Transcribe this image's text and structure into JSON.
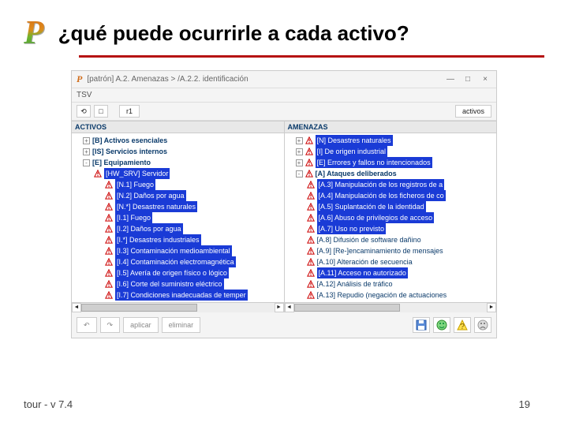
{
  "slide": {
    "title": "¿qué puede ocurrirle a cada activo?",
    "footer_left": "tour - v 7.4",
    "page_no": "19"
  },
  "app": {
    "titlebar": "[patrón] A.2. Amenazas > /A.2.2. identificación",
    "tab": "TSV",
    "toolbar": {
      "t1": "⟲",
      "t2": "□",
      "t3": "r1",
      "right": "activos"
    },
    "left_header": "ACTIVOS",
    "right_header": "AMENAZAS",
    "left_tree": [
      {
        "ind": 1,
        "plus": "+",
        "icon": "",
        "label": "[B] Activos esenciales",
        "cls": "public"
      },
      {
        "ind": 1,
        "plus": "+",
        "icon": "",
        "label": "[IS] Servicios internos",
        "cls": "public"
      },
      {
        "ind": 1,
        "plus": "-",
        "icon": "",
        "label": "[E] Equipamiento",
        "cls": "public"
      },
      {
        "ind": 2,
        "plus": "",
        "icon": "w",
        "label": "[HW_SRV] Servidor",
        "cls": "sel"
      },
      {
        "ind": 3,
        "plus": "",
        "icon": "w",
        "label": "[N.1] Fuego",
        "cls": "sel"
      },
      {
        "ind": 3,
        "plus": "",
        "icon": "w",
        "label": "[N.2] Daños por agua",
        "cls": "sel"
      },
      {
        "ind": 3,
        "plus": "",
        "icon": "w",
        "label": "[N.*] Desastres naturales",
        "cls": "sel"
      },
      {
        "ind": 3,
        "plus": "",
        "icon": "w",
        "label": "[I.1] Fuego",
        "cls": "sel"
      },
      {
        "ind": 3,
        "plus": "",
        "icon": "w",
        "label": "[I.2] Daños por agua",
        "cls": "sel"
      },
      {
        "ind": 3,
        "plus": "",
        "icon": "w",
        "label": "[I.*] Desastres industriales",
        "cls": "sel"
      },
      {
        "ind": 3,
        "plus": "",
        "icon": "w",
        "label": "[I.3] Contaminación medioambiental",
        "cls": "sel"
      },
      {
        "ind": 3,
        "plus": "",
        "icon": "w",
        "label": "[I.4] Contaminación electromagnética",
        "cls": "sel"
      },
      {
        "ind": 3,
        "plus": "",
        "icon": "w",
        "label": "[I.5] Avería de origen físico o lógico",
        "cls": "sel"
      },
      {
        "ind": 3,
        "plus": "",
        "icon": "w",
        "label": "[I.6] Corte del suministro eléctrico",
        "cls": "sel"
      },
      {
        "ind": 3,
        "plus": "",
        "icon": "w",
        "label": "[I.7] Condiciones inadecuadas de temper",
        "cls": "sel"
      }
    ],
    "right_tree": [
      {
        "ind": 1,
        "plus": "+",
        "icon": "w",
        "label": "[N] Desastres naturales",
        "cls": "sel"
      },
      {
        "ind": 1,
        "plus": "+",
        "icon": "w",
        "label": "[I] De origen industrial",
        "cls": "sel"
      },
      {
        "ind": 1,
        "plus": "+",
        "icon": "w",
        "label": "[E] Errores y fallos no intencionados",
        "cls": "sel"
      },
      {
        "ind": 1,
        "plus": "-",
        "icon": "w",
        "label": "[A] Ataques deliberados",
        "cls": "public"
      },
      {
        "ind": 2,
        "plus": "",
        "icon": "w",
        "label": "[A.3] Manipulación de los registros de a",
        "cls": "sel"
      },
      {
        "ind": 2,
        "plus": "",
        "icon": "w",
        "label": "[A.4] Manipulación de los ficheros de co",
        "cls": "sel"
      },
      {
        "ind": 2,
        "plus": "",
        "icon": "w",
        "label": "[A.5] Suplantación de la identidad",
        "cls": "sel"
      },
      {
        "ind": 2,
        "plus": "",
        "icon": "w",
        "label": "[A.6] Abuso de privilegios de acceso",
        "cls": "sel"
      },
      {
        "ind": 2,
        "plus": "",
        "icon": "w",
        "label": "[A.7] Uso no previsto",
        "cls": "sel"
      },
      {
        "ind": 2,
        "plus": "",
        "icon": "w",
        "label": "[A.8] Difusión de software dañino",
        "cls": "lbl"
      },
      {
        "ind": 2,
        "plus": "",
        "icon": "w",
        "label": "[A.9] [Re-]encaminamiento de mensajes",
        "cls": "lbl"
      },
      {
        "ind": 2,
        "plus": "",
        "icon": "w",
        "label": "[A.10] Alteración de secuencia",
        "cls": "lbl"
      },
      {
        "ind": 2,
        "plus": "",
        "icon": "w",
        "label": "[A.11] Acceso no autorizado",
        "cls": "sel"
      },
      {
        "ind": 2,
        "plus": "",
        "icon": "w",
        "label": "[A.12] Análisis de tráfico",
        "cls": "lbl"
      },
      {
        "ind": 2,
        "plus": "",
        "icon": "w",
        "label": "[A.13] Repudio (negación de actuaciones",
        "cls": "lbl"
      }
    ],
    "buttons": {
      "undo": "↶",
      "redo": "↷",
      "apply": "aplicar",
      "remove": "eliminar"
    }
  }
}
